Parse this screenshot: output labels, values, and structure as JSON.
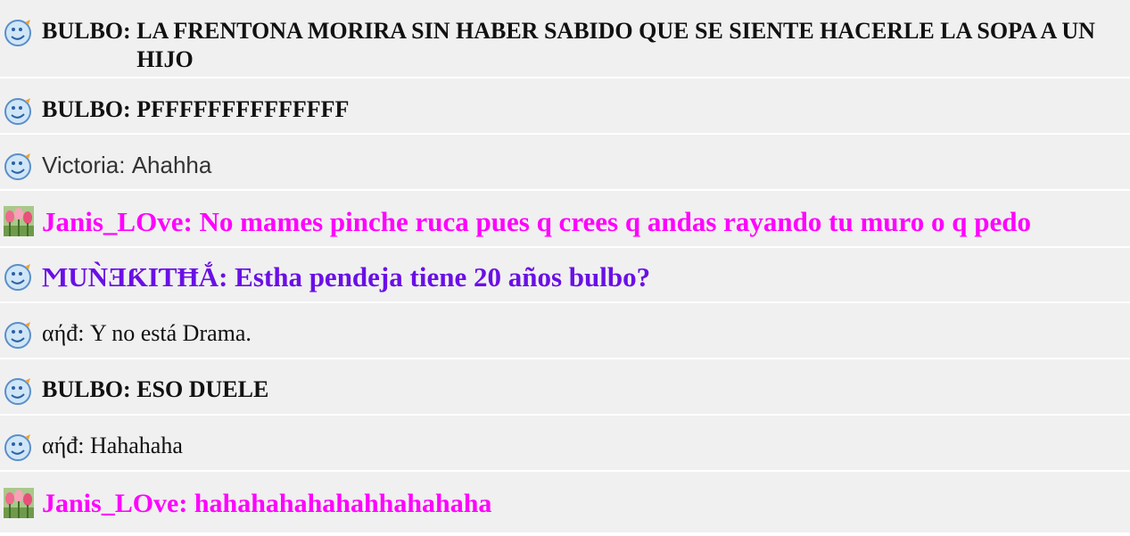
{
  "colors": {
    "black": "#111111",
    "gray": "#333333",
    "magenta": "#ff00ff",
    "purple": "#6a0fe6"
  },
  "messages": [
    {
      "icon": "bird-emoticon-icon",
      "author": "BULBO: ",
      "text": "LA FRENTONA MORIRA SIN HABER SABIDO QUE SE SIENTE HACERLE LA SOPA A UN HIJO"
    },
    {
      "icon": "bird-emoticon-icon",
      "author": "BULBO: ",
      "text": "PFFFFFFFFFFFFFF"
    },
    {
      "icon": "bird-emoticon-icon",
      "author": "Victoria: ",
      "text": "Ahahha"
    },
    {
      "icon": "tulips-avatar-icon",
      "author": "Janis_LOve: ",
      "text": "No mames pinche ruca pues q crees q andas rayando tu muro o q pedo"
    },
    {
      "icon": "bird-emoticon-icon",
      "author": "ϺUǸƎƘIƬĦẮ: ",
      "text": "Estha pendeja tiene 20 años bulbo?"
    },
    {
      "icon": "bird-emoticon-icon",
      "author": "αήđ: ",
      "text": "Y no está Drama."
    },
    {
      "icon": "bird-emoticon-icon",
      "author": "BULBO: ",
      "text": "ESO DUELE"
    },
    {
      "icon": "bird-emoticon-icon",
      "author": "αήđ: ",
      "text": "Hahahaha"
    },
    {
      "icon": "tulips-avatar-icon",
      "author": "Janis_LOve: ",
      "text": "hahahahahahahhahahaha"
    }
  ]
}
